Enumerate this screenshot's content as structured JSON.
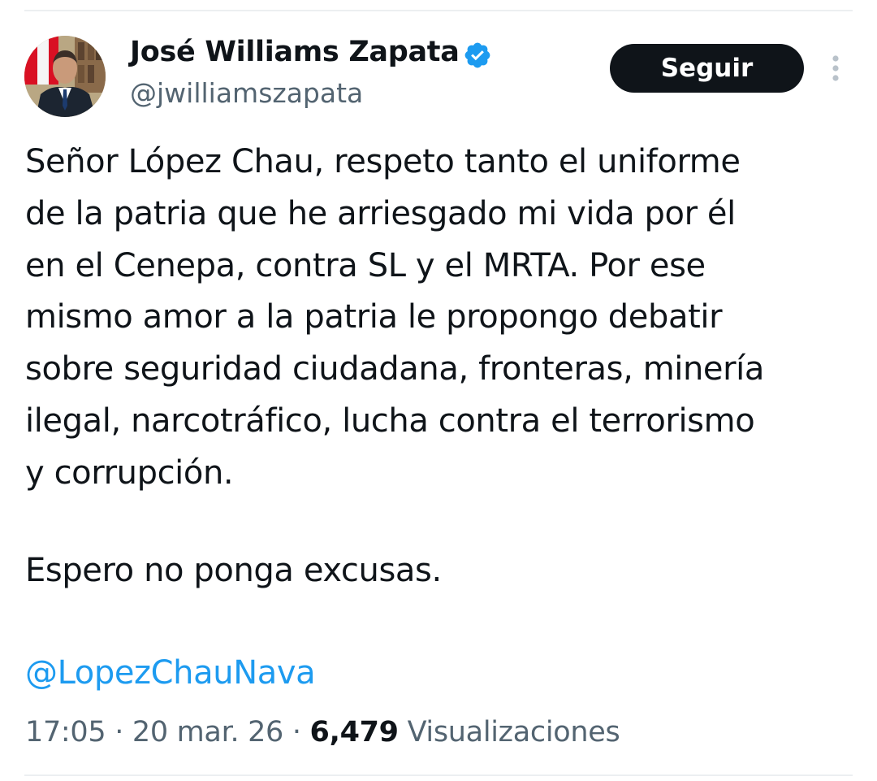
{
  "author": {
    "name": "José Williams Zapata",
    "handle": "@jwilliamszapata",
    "verified_icon": "verified-badge-icon",
    "badge_color": "#1d9bf0"
  },
  "actions": {
    "follow_label": "Seguir",
    "more_icon": "more-vertical-icon"
  },
  "tweet": {
    "text": "Señor López Chau, respeto tanto el uniforme\nde la patria que he arriesgado mi vida por él\nen el Cenepa, contra SL y el MRTA.  Por ese\nmismo amor a la patria le propongo debatir\nsobre seguridad ciudadana, fronteras, minería\nilegal, narcotráfico, lucha contra el terrorismo\ny corrupción.",
    "closing": "Espero no ponga excusas.",
    "mention": "@LopezChauNava"
  },
  "meta": {
    "time": "17:05",
    "separator": "·",
    "date": "20 mar. 26",
    "views_count": "6,479",
    "views_label": "Visualizaciones"
  },
  "colors": {
    "text": "#0f1419",
    "secondary": "#536471",
    "link": "#1d9bf0",
    "button_bg": "#0f1419"
  }
}
